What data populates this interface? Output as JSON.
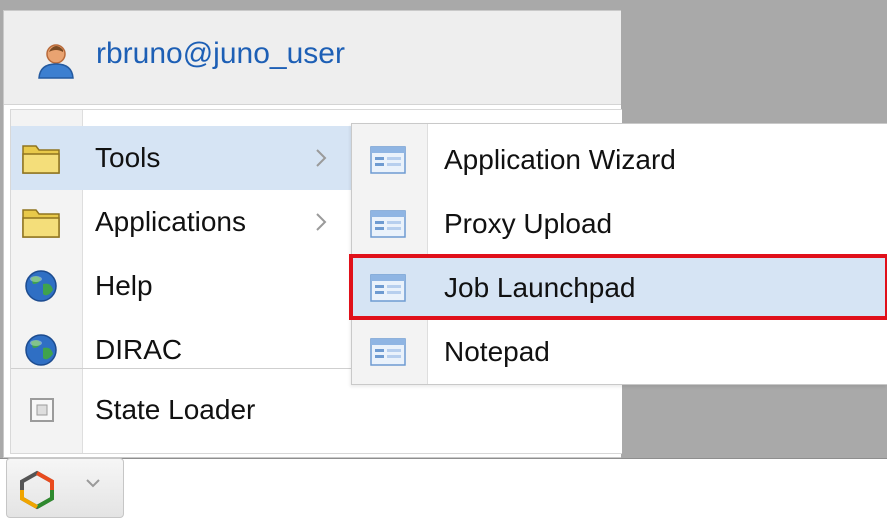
{
  "user": {
    "name": "rbruno@juno_user",
    "icon": "user-icon"
  },
  "menu": {
    "items": [
      {
        "label": "Tools",
        "icon": "folder-icon",
        "has_submenu": true,
        "active": true
      },
      {
        "label": "Applications",
        "icon": "folder-icon",
        "has_submenu": true,
        "active": false
      },
      {
        "label": "Help",
        "icon": "globe-icon",
        "has_submenu": false,
        "active": false
      },
      {
        "label": "DIRAC",
        "icon": "globe-icon",
        "has_submenu": false,
        "active": false
      },
      {
        "label": "State Loader",
        "icon": "state-loader-icon",
        "has_submenu": false,
        "active": false
      }
    ]
  },
  "submenu": {
    "parent": "Tools",
    "items": [
      {
        "label": "Application Wizard",
        "icon": "app-window-icon"
      },
      {
        "label": "Proxy Upload",
        "icon": "app-window-icon"
      },
      {
        "label": "Job Launchpad",
        "icon": "app-window-icon",
        "highlighted": true
      },
      {
        "label": "Notepad",
        "icon": "app-window-icon"
      }
    ]
  },
  "colors": {
    "accent_text": "#1d5fb5",
    "active_row": "#d6e4f4",
    "highlight_border": "#e0101a",
    "desktop": "#a9a9a9"
  }
}
